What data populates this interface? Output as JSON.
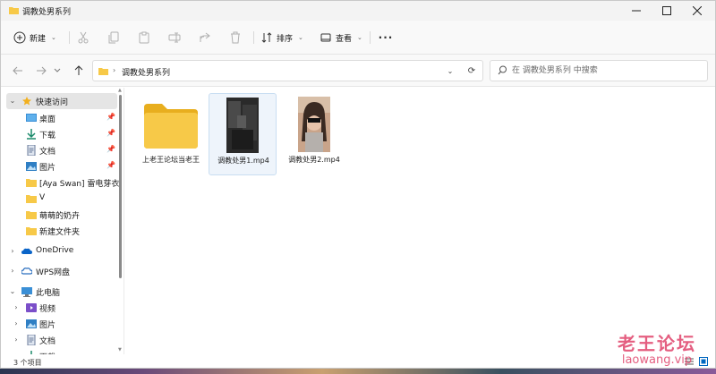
{
  "window": {
    "title": "调教处男系列",
    "controls": [
      "minimize-icon",
      "maximize-icon",
      "close-icon"
    ]
  },
  "toolbar": {
    "new_label": "新建",
    "sort_label": "排序",
    "view_label": "查看",
    "icons": [
      "cut-icon",
      "copy-icon",
      "paste-icon",
      "rename-icon",
      "share-icon",
      "delete-icon"
    ]
  },
  "address": {
    "path": "调教处男系列",
    "search_placeholder": "在 调教处男系列 中搜索"
  },
  "sidebar": {
    "quick_access": "快速访问",
    "pinned": [
      {
        "label": "桌面",
        "icon": "desktop-icon"
      },
      {
        "label": "下载",
        "icon": "download-icon"
      },
      {
        "label": "文档",
        "icon": "document-icon"
      },
      {
        "label": "图片",
        "icon": "picture-icon"
      }
    ],
    "folders": [
      "[Aya Swan] 雷电芽衣·]",
      "V",
      "萌萌的奶卉",
      "新建文件夹"
    ],
    "onedrive": "OneDrive",
    "wps": "WPS网盘",
    "this_pc": "此电脑",
    "pc_items": [
      {
        "label": "视频",
        "icon": "video-icon"
      },
      {
        "label": "图片",
        "icon": "picture-icon"
      },
      {
        "label": "文档",
        "icon": "document-icon"
      },
      {
        "label": "下载",
        "icon": "download-icon"
      }
    ]
  },
  "files": [
    {
      "name": "上老王论坛当老王",
      "type": "folder"
    },
    {
      "name": "调教处男1.mp4",
      "type": "video"
    },
    {
      "name": "调教处男2.mp4",
      "type": "video"
    }
  ],
  "status": {
    "item_count": "3 个项目"
  },
  "watermark": {
    "title": "老王论坛",
    "subtitle": "laowang.vip"
  },
  "colors": {
    "folder": "#f7c948",
    "accent": "#0067c0",
    "watermark": "#e0436a"
  }
}
